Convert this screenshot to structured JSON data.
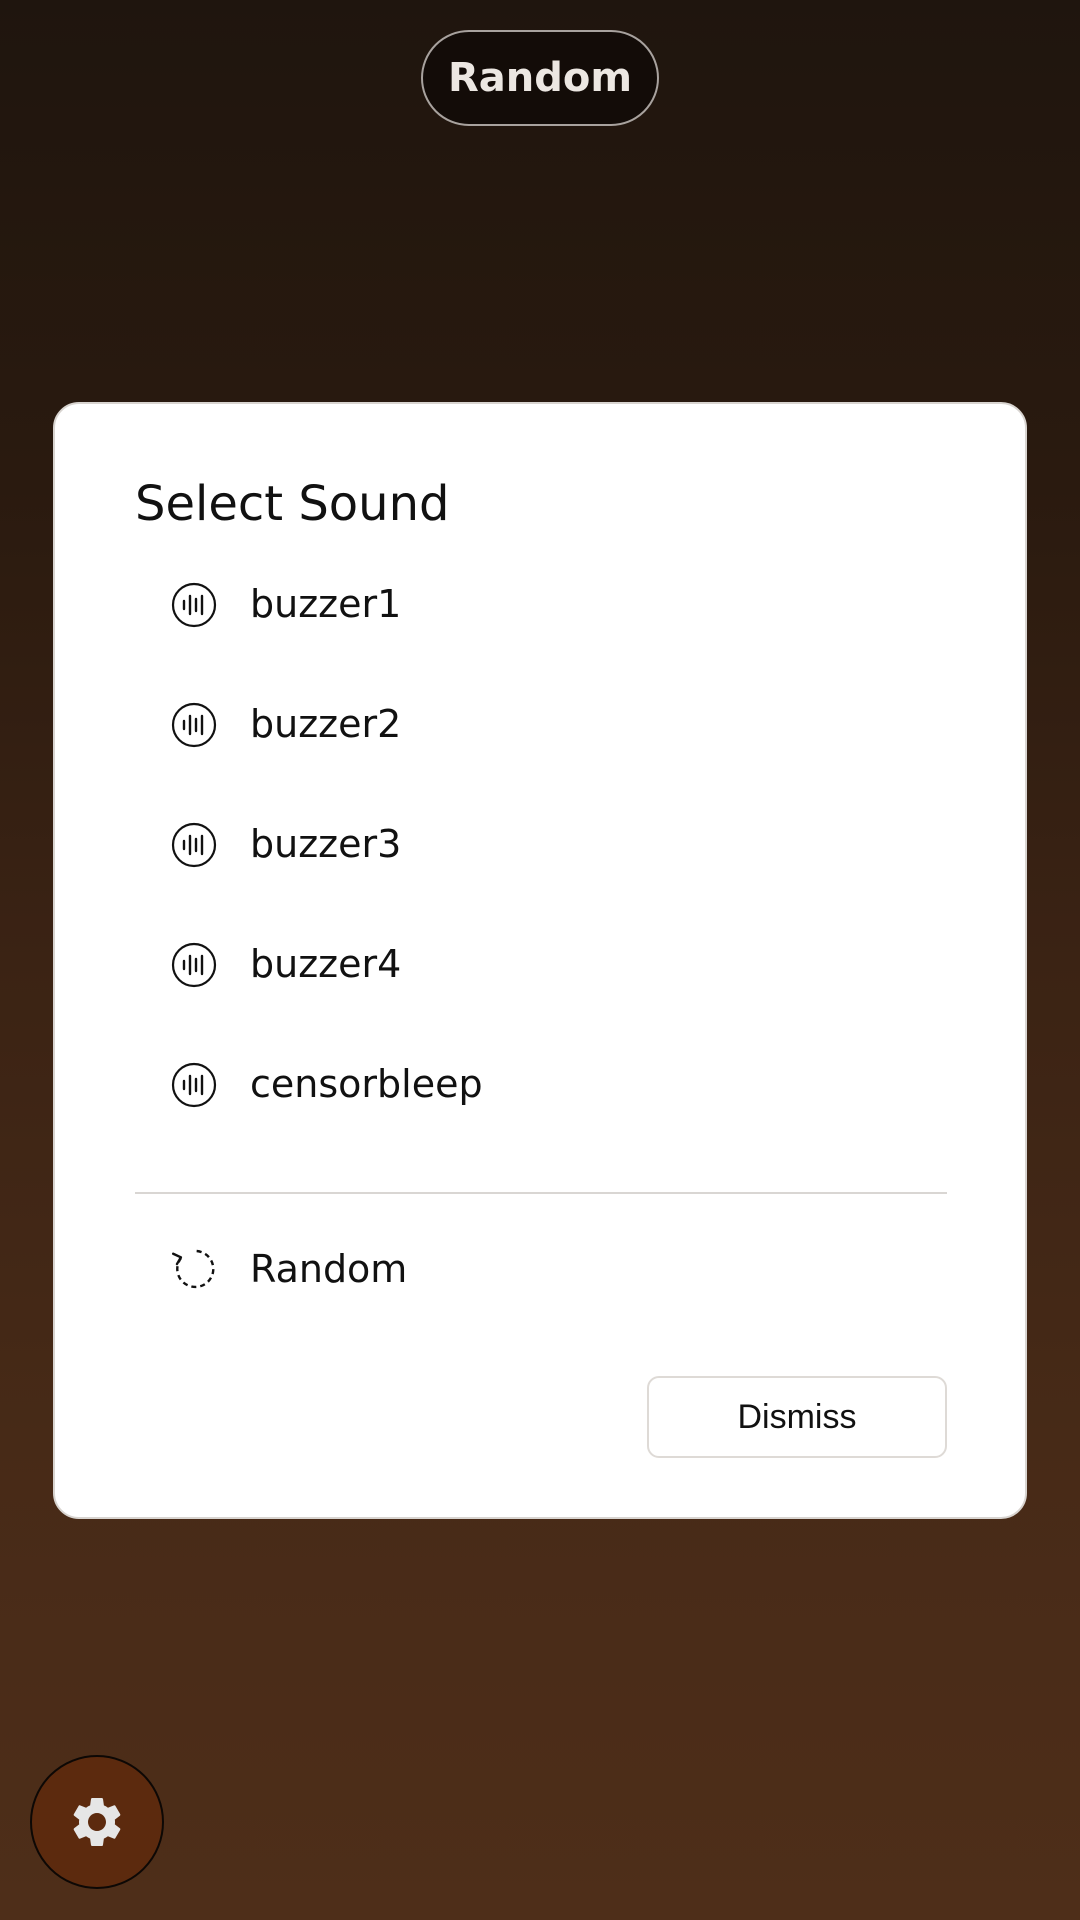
{
  "header": {
    "random_button_label": "Random"
  },
  "dialog": {
    "title": "Select Sound",
    "sounds": [
      {
        "label": "buzzer1",
        "icon": "sound-waves-icon"
      },
      {
        "label": "buzzer2",
        "icon": "sound-waves-icon"
      },
      {
        "label": "buzzer3",
        "icon": "sound-waves-icon"
      },
      {
        "label": "buzzer4",
        "icon": "sound-waves-icon"
      },
      {
        "label": "censorbleep",
        "icon": "sound-waves-icon"
      }
    ],
    "random_option": {
      "label": "Random",
      "icon": "shuffle-circle-icon"
    },
    "dismiss_label": "Dismiss"
  },
  "settings": {
    "icon": "gear-icon"
  },
  "colors": {
    "background_top": "#1f150e",
    "background_bottom": "#4e2e19",
    "fab": "#5c2a0e",
    "dialog": "#ffffff"
  }
}
